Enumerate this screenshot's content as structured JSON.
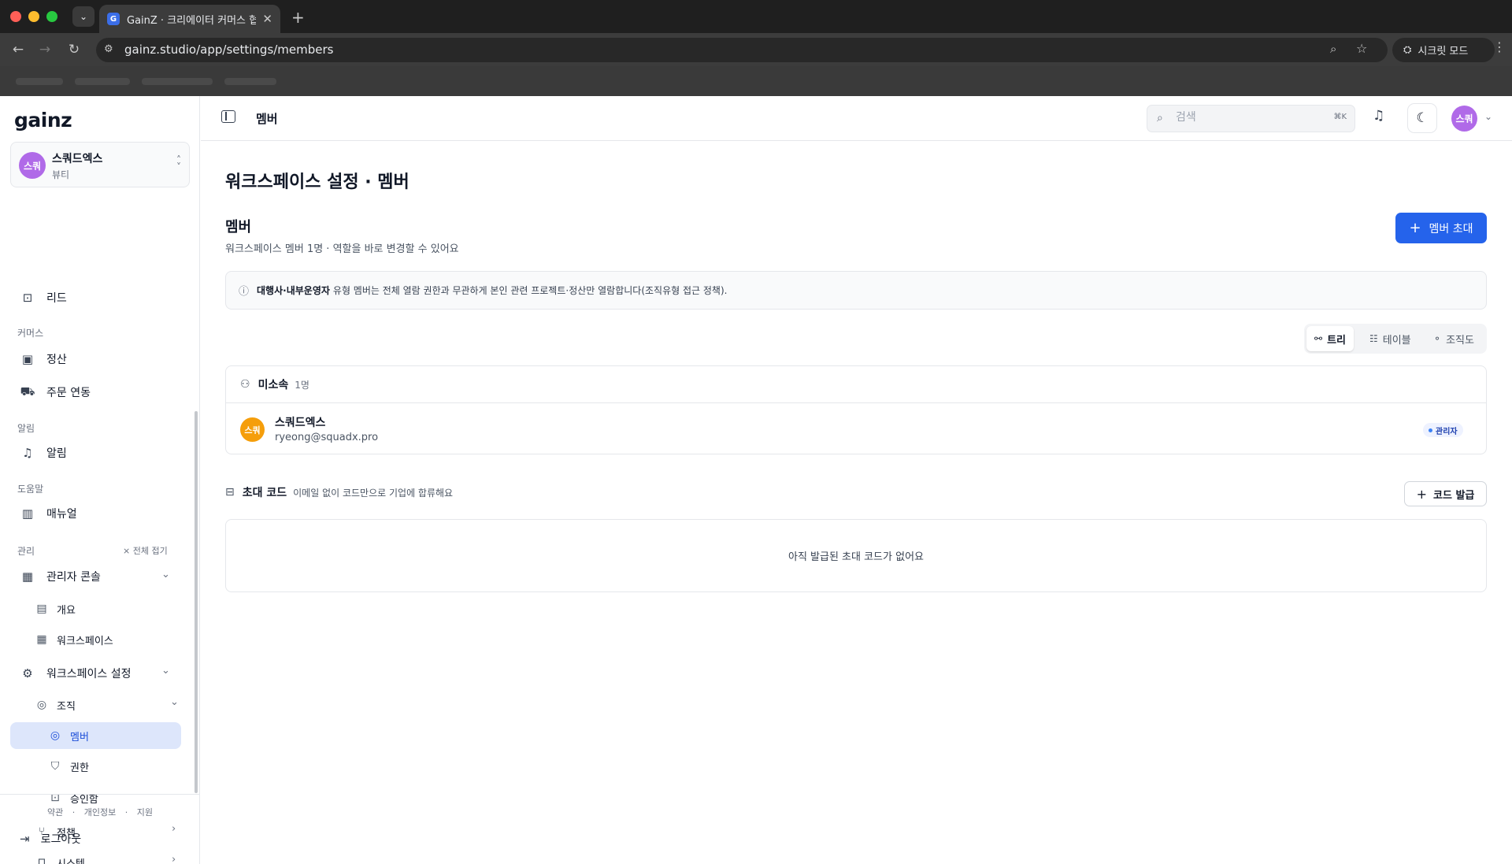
{
  "browser": {
    "tab_title": "GainZ · 크리에이터 커머스 협업 C",
    "tab_favicon": "G",
    "url": "gainz.studio/app/settings/members",
    "incognito_label": "시크릿 모드"
  },
  "sidebar": {
    "logo": "gainz",
    "workspace": {
      "avatar": "스쿼",
      "name": "스쿼드엑스",
      "sub": "뷰티"
    },
    "items": {
      "leads": "리드",
      "commerce_section": "커머스",
      "settlement": "정산",
      "order_sync": "주문 연동",
      "alerts_section": "알림",
      "alerts": "알림",
      "help_section": "도움말",
      "manual": "매뉴얼",
      "admin_section": "관리",
      "collapse_all": "전체 접기",
      "admin_console": "관리자 콘솔",
      "overview": "개요",
      "workspace": "워크스페이스",
      "workspace_settings": "워크스페이스 설정",
      "organization": "조직",
      "members": "멤버",
      "permissions": "권한",
      "approvals": "승인함",
      "policy": "정책",
      "system": "시스템"
    },
    "footer": {
      "terms": "약관",
      "privacy": "개인정보",
      "support": "지원",
      "sep": "·",
      "logout": "로그아웃"
    }
  },
  "header": {
    "crumb": "멤버",
    "search_placeholder": "검색",
    "search_shortcut": "⌘K",
    "user_avatar": "스쿼"
  },
  "content": {
    "page_title": "워크스페이스 설정 · 멤버",
    "section_title": "멤버",
    "section_desc": "워크스페이스 멤버 1명 · 역할을 바로 변경할 수 있어요",
    "invite_button": "멤버 초대",
    "notice_bold": "대행사·내부운영자",
    "notice_text": "유형 멤버는 전체 열람 권한과 무관하게 본인 관련 프로젝트·정산만 열람합니다(조직유형 접근 정책).",
    "views": {
      "tree": "트리",
      "table": "테이블",
      "org_chart": "조직도"
    },
    "group": {
      "name": "미소속",
      "count": "1명"
    },
    "member": {
      "avatar": "스쿼",
      "name": "스쿼드엑스",
      "email": "ryeong@squadx.pro",
      "role": "관리자"
    },
    "invite_code": {
      "title": "초대 코드",
      "desc": "이메일 없이 코드만으로 기업에 합류해요",
      "issue_button": "코드 발급",
      "empty": "아직 발급된 초대 코드가 없어요"
    }
  },
  "colors": {
    "accent": "#2563eb",
    "active_bg": "#dde6fb",
    "avatar_purple": "#b06ae8",
    "avatar_orange": "#f59e0b"
  }
}
